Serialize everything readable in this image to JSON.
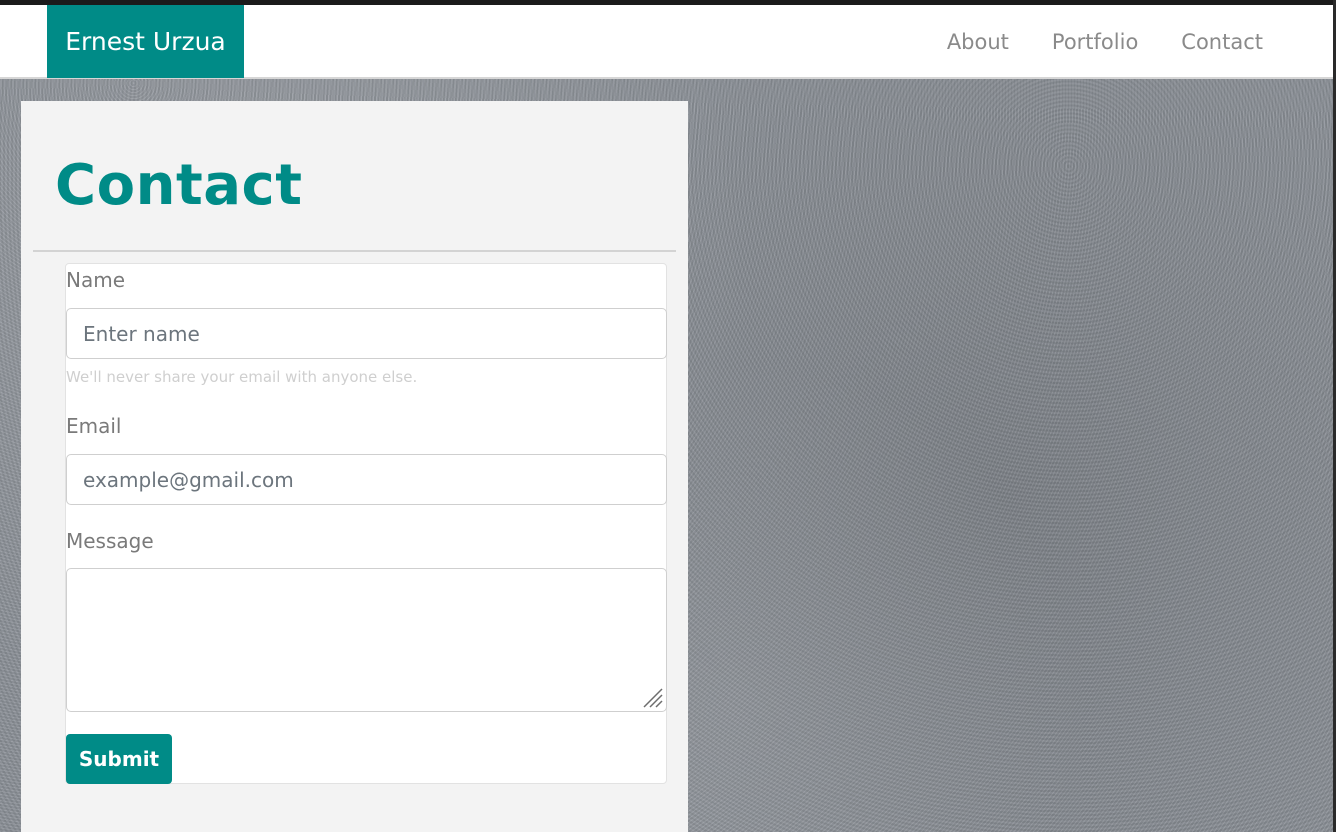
{
  "navbar": {
    "brand": "Ernest Urzua",
    "links": [
      {
        "label": "About"
      },
      {
        "label": "Portfolio"
      },
      {
        "label": "Contact"
      }
    ]
  },
  "page": {
    "title": "Contact"
  },
  "form": {
    "name": {
      "label": "Name",
      "placeholder": "Enter name",
      "value": "",
      "help": "We'll never share your email with anyone else."
    },
    "email": {
      "label": "Email",
      "placeholder": "example@gmail.com",
      "value": ""
    },
    "message": {
      "label": "Message",
      "value": ""
    },
    "submit_label": "Submit"
  },
  "colors": {
    "accent": "#008b87",
    "nav_text": "#8a8a8a",
    "panel_bg": "#f3f3f3",
    "page_bg": "#8d9299"
  },
  "icons": {
    "resize": "resize-grip-icon"
  }
}
